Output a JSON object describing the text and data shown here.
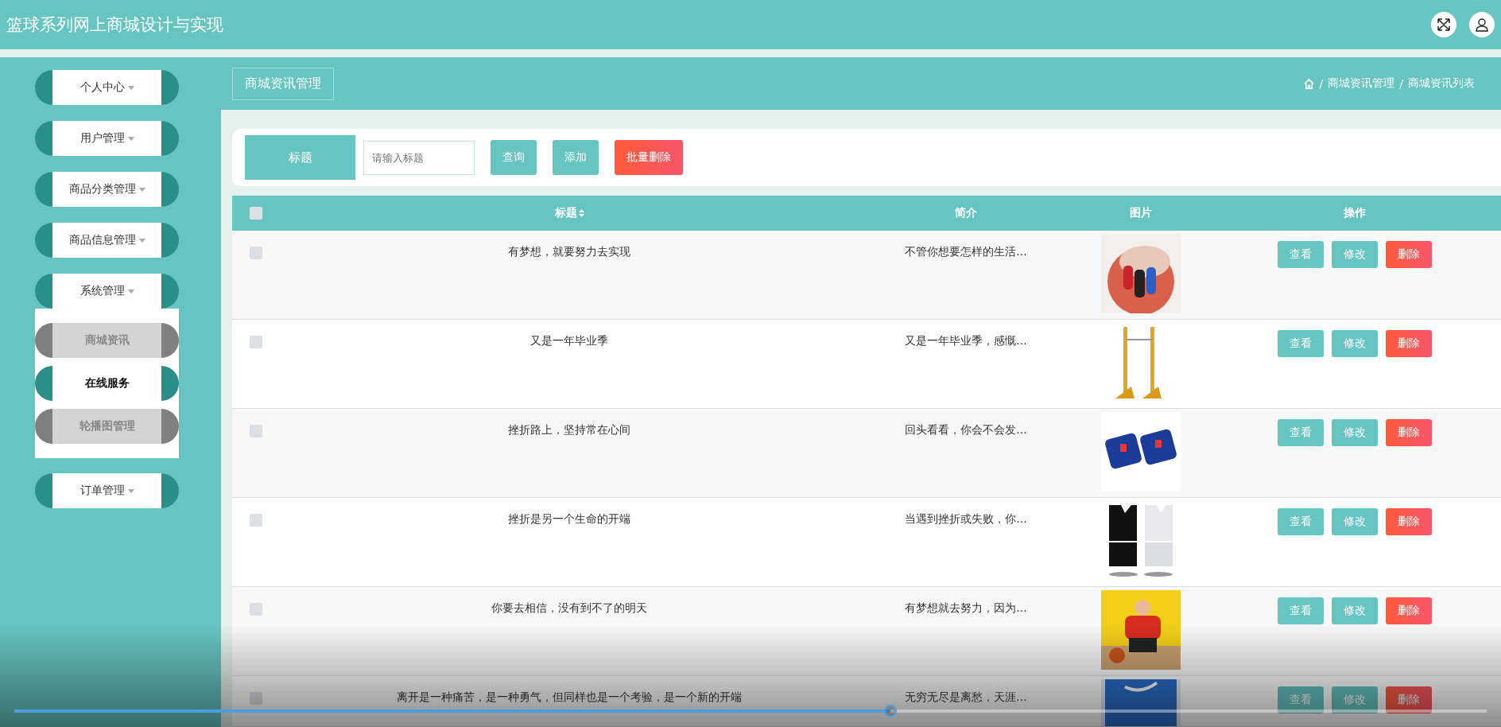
{
  "header": {
    "title": "篮球系列网上商城设计与实现"
  },
  "sidebar": {
    "items": [
      {
        "label": "个人中心"
      },
      {
        "label": "用户管理"
      },
      {
        "label": "商品分类管理"
      },
      {
        "label": "商品信息管理"
      },
      {
        "label": "系统管理",
        "children": [
          {
            "label": "商城资讯",
            "highlighted": false
          },
          {
            "label": "在线服务",
            "highlighted": true
          },
          {
            "label": "轮播图管理",
            "highlighted": false
          }
        ]
      },
      {
        "label": "订单管理"
      }
    ]
  },
  "page_title": "商城资讯管理",
  "breadcrumb": [
    {
      "separator": "/",
      "label": "商城资讯管理"
    },
    {
      "separator": "/",
      "label": "商城资讯列表"
    }
  ],
  "search": {
    "label": "标题",
    "placeholder": "请输入标题",
    "buttons": [
      {
        "label": "查询",
        "kind": "primary"
      },
      {
        "label": "添加",
        "kind": "primary"
      },
      {
        "label": "批量删除",
        "kind": "danger"
      }
    ]
  },
  "table": {
    "all_checked": false,
    "columns": [
      "标题",
      "简介",
      "图片",
      "操作"
    ],
    "rows": [
      {
        "checked": false,
        "title": "有梦想，就要努力去实现",
        "summary": "不管你想要怎样的生活...",
        "picture": {
          "kind": "picture"
        },
        "actions": [
          {
            "label": "查看",
            "kind": "primary"
          },
          {
            "label": "修改",
            "kind": "primary"
          },
          {
            "label": "删除",
            "kind": "danger"
          }
        ]
      },
      {
        "checked": false,
        "title": "又是一年毕业季",
        "summary": "又是一年毕业季，感慨...",
        "picture": {
          "kind": "picture"
        },
        "actions": [
          {
            "label": "查看",
            "kind": "primary"
          },
          {
            "label": "修改",
            "kind": "primary"
          },
          {
            "label": "删除",
            "kind": "danger"
          }
        ]
      },
      {
        "checked": false,
        "title": "挫折路上，坚持常在心间",
        "summary": "回头看看，你会不会发...",
        "picture": {
          "kind": "picture"
        },
        "actions": [
          {
            "label": "查看",
            "kind": "primary"
          },
          {
            "label": "修改",
            "kind": "primary"
          },
          {
            "label": "删除",
            "kind": "danger"
          }
        ]
      },
      {
        "checked": false,
        "title": "挫折是另一个生命的开端",
        "summary": "当遇到挫折或失败，你...",
        "picture": {
          "kind": "picture"
        },
        "actions": [
          {
            "label": "查看",
            "kind": "primary"
          },
          {
            "label": "修改",
            "kind": "primary"
          },
          {
            "label": "删除",
            "kind": "danger"
          }
        ]
      },
      {
        "checked": false,
        "title": "你要去相信，没有到不了的明天",
        "summary": "有梦想就去努力，因为...",
        "picture": {
          "kind": "picture"
        },
        "actions": [
          {
            "label": "查看",
            "kind": "primary"
          },
          {
            "label": "修改",
            "kind": "primary"
          },
          {
            "label": "删除",
            "kind": "danger"
          }
        ]
      },
      {
        "checked": false,
        "title": "离开是一种痛苦，是一种勇气，但同样也是一个考验，是一个新的开端",
        "summary": "无穷无尽是离愁，天涯...",
        "picture": {
          "kind": "picture"
        },
        "actions": [
          {
            "label": "查看",
            "kind": "primary"
          },
          {
            "label": "修改",
            "kind": "primary"
          },
          {
            "label": "删除",
            "kind": "danger"
          }
        ]
      }
    ]
  },
  "player": {
    "level": 0.595
  }
}
